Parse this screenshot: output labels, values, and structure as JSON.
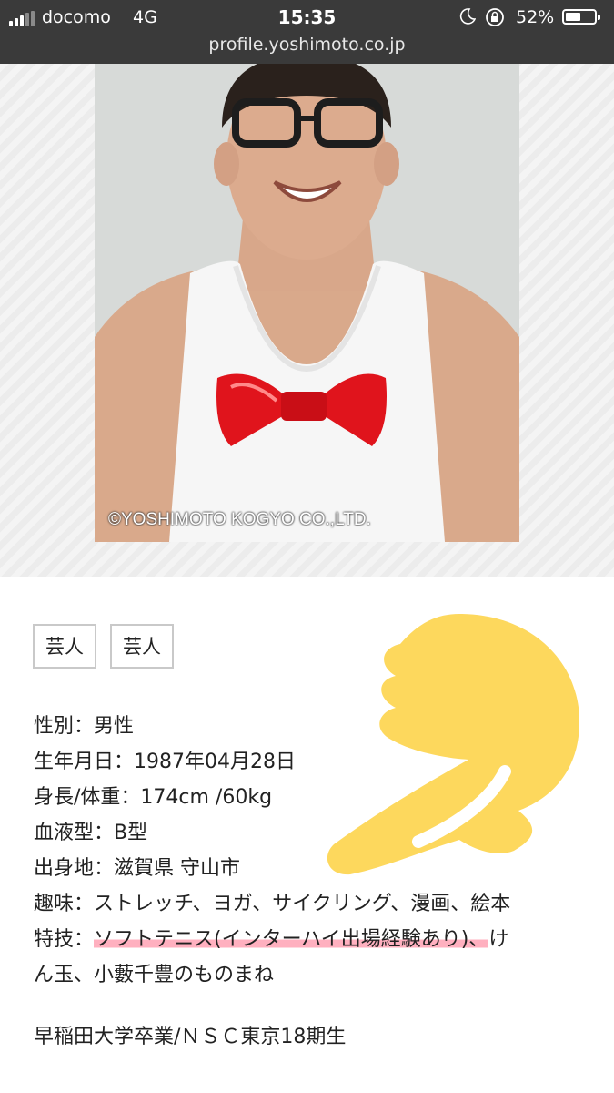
{
  "status_bar": {
    "carrier": "docomo",
    "network": "4G",
    "time": "15:35",
    "battery_percent": "52%",
    "url": "profile.yoshimoto.co.jp"
  },
  "photo": {
    "copyright": "©YOSHIMOTO KOGYO CO.,LTD."
  },
  "tags": [
    "芸人",
    "芸人"
  ],
  "profile": {
    "gender": "性別：男性",
    "birthday": "生年月日：1987年04月28日",
    "height_weight": "身長/体重：174cm /60kg",
    "blood_type": "血液型：B型",
    "hometown": "出身地：滋賀県 守山市",
    "hobbies": "趣味：ストレッチ、ヨガ、サイクリング、漫画、絵本",
    "skills_label": "特技：",
    "skills_highlight": "ソフトテニス(インターハイ出場経験あり)、",
    "skills_rest_1": "け",
    "skills_rest_2": "ん玉、小藪千豊のものまね",
    "education": "早稲田大学卒業/ＮＳＣ東京18期生"
  },
  "colors": {
    "status_bar_bg": "#3a3a3a",
    "highlight": "#ff96aa",
    "pointer": "#fdd85d"
  }
}
